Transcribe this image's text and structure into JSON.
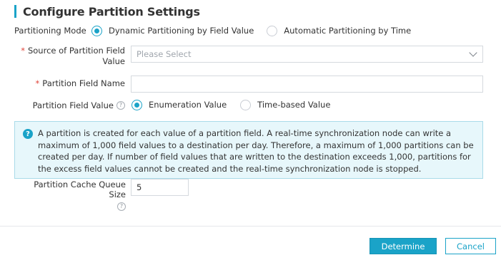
{
  "dialog": {
    "title": "Configure Partition Settings"
  },
  "partitioning_mode": {
    "label": "Partitioning Mode",
    "options": [
      {
        "label": "Dynamic Partitioning by Field Value",
        "checked": true
      },
      {
        "label": "Automatic Partitioning by Time",
        "checked": false
      }
    ]
  },
  "source_field": {
    "required_mark": "*",
    "label_line1": "Source of Partition Field",
    "label_line2": "Value",
    "placeholder": "Please Select"
  },
  "field_name": {
    "required_mark": "*",
    "label": "Partition Field Name",
    "value": ""
  },
  "field_value": {
    "label": "Partition Field Value",
    "help": "?",
    "options": [
      {
        "label": "Enumeration Value",
        "checked": true
      },
      {
        "label": "Time-based Value",
        "checked": false
      }
    ]
  },
  "info": {
    "icon": "?",
    "text": "A partition is created for each value of a partition field. A real-time synchronization node can write a maximum of 1,000 field values to a destination per day. Therefore, a maximum of 1,000 partitions can be created per day. If number of field values that are written to the destination exceeds 1,000, partitions for the excess field values cannot be created and the real-time synchronization node is stopped."
  },
  "cache_queue": {
    "label": "Partition Cache Queue Size",
    "help": "?",
    "value": "5"
  },
  "footer": {
    "determine_label": "Determine",
    "cancel_label": "Cancel"
  },
  "colors": {
    "accent": "#1aa3c8",
    "required": "#e0453a",
    "info_bg": "#e7f7fb"
  }
}
